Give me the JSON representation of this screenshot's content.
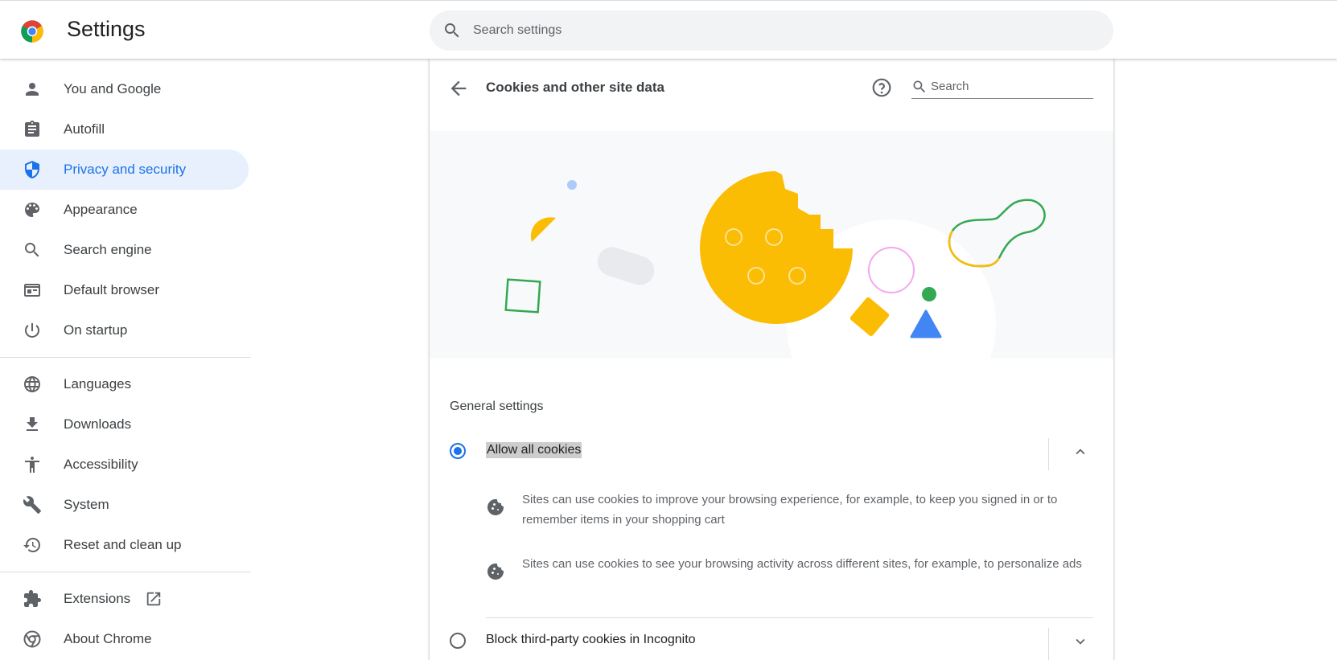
{
  "header": {
    "title": "Settings",
    "search_placeholder": "Search settings"
  },
  "sidebar": {
    "items": [
      {
        "label": "You and Google",
        "icon": "person-icon"
      },
      {
        "label": "Autofill",
        "icon": "clipboard-icon"
      },
      {
        "label": "Privacy and security",
        "icon": "shield-icon",
        "active": true
      },
      {
        "label": "Appearance",
        "icon": "palette-icon"
      },
      {
        "label": "Search engine",
        "icon": "search-icon"
      },
      {
        "label": "Default browser",
        "icon": "browser-window-icon"
      },
      {
        "label": "On startup",
        "icon": "power-icon"
      }
    ],
    "advanced_items": [
      {
        "label": "Languages",
        "icon": "globe-icon"
      },
      {
        "label": "Downloads",
        "icon": "download-icon"
      },
      {
        "label": "Accessibility",
        "icon": "accessibility-icon"
      },
      {
        "label": "System",
        "icon": "wrench-icon"
      },
      {
        "label": "Reset and clean up",
        "icon": "restore-icon"
      }
    ],
    "footer_items": [
      {
        "label": "Extensions",
        "icon": "puzzle-icon"
      },
      {
        "label": "About Chrome",
        "icon": "chrome-icon"
      }
    ]
  },
  "page": {
    "title": "Cookies and other site data",
    "search_placeholder": "Search",
    "section_title": "General settings",
    "options": [
      {
        "label": "Allow all cookies",
        "selected": true,
        "expanded": true,
        "descriptions": [
          "Sites can use cookies to improve your browsing experience, for example, to keep you signed in or to remember items in your shopping cart",
          "Sites can use cookies to see your browsing activity across different sites, for example, to personalize ads"
        ]
      },
      {
        "label": "Block third-party cookies in Incognito",
        "selected": false,
        "expanded": false
      }
    ]
  },
  "colors": {
    "accent": "#1a73e8",
    "active_bg": "#e8f0fe",
    "cookie_yellow": "#fbbc04",
    "green": "#34a853",
    "blue": "#4285f4",
    "pink": "#f4a7f0"
  }
}
